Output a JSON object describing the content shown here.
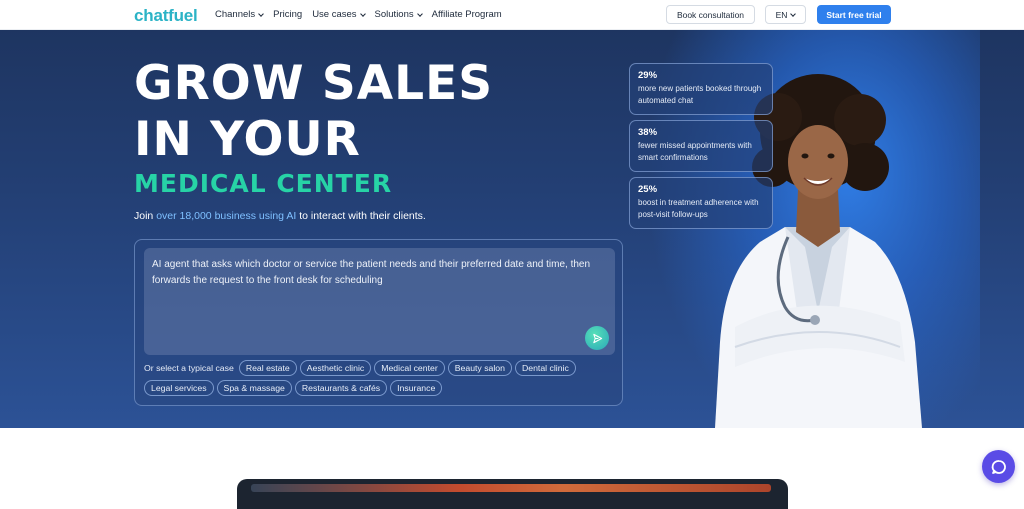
{
  "nav": {
    "logo": "chatfuel",
    "items": [
      {
        "label": "Channels",
        "dropdown": true
      },
      {
        "label": "Pricing",
        "dropdown": false
      },
      {
        "label": "Use cases",
        "dropdown": true
      },
      {
        "label": "Solutions",
        "dropdown": true
      },
      {
        "label": "Affiliate Program",
        "dropdown": false
      }
    ],
    "consult_label": "Book consultation",
    "lang_label": "EN",
    "trial_label": "Start free trial"
  },
  "hero": {
    "title_line1": "GROW SALES",
    "title_line2": "IN YOUR",
    "title_line3": "MEDICAL CENTER",
    "sub_prefix": "Join ",
    "sub_highlight": "over 18,000 business using AI",
    "sub_suffix": " to interact with their clients.",
    "prompt_text": "AI agent that asks which doctor or service the patient needs and their preferred date and time, then forwards the request to the front desk for scheduling",
    "cases_label": "Or select a typical case",
    "cases": [
      "Real estate",
      "Aesthetic clinic",
      "Medical center",
      "Beauty salon",
      "Dental clinic",
      "Legal services",
      "Spa & massage",
      "Restaurants & cafés",
      "Insurance"
    ]
  },
  "stats": [
    {
      "value": "29%",
      "desc": "more new patients booked through automated chat"
    },
    {
      "value": "38%",
      "desc": "fewer missed appointments with smart confirmations"
    },
    {
      "value": "25%",
      "desc": "boost in treatment adherence with post-visit follow-ups"
    }
  ],
  "colors": {
    "brand_teal": "#2bb3c6",
    "accent_green": "#27d3a6",
    "primary_blue": "#2f80ed",
    "hero_bg": "#233f74",
    "chat_purple": "#5a4be6"
  },
  "icons": [
    "chevron-down-icon",
    "send-icon",
    "chat-bubble-icon"
  ]
}
